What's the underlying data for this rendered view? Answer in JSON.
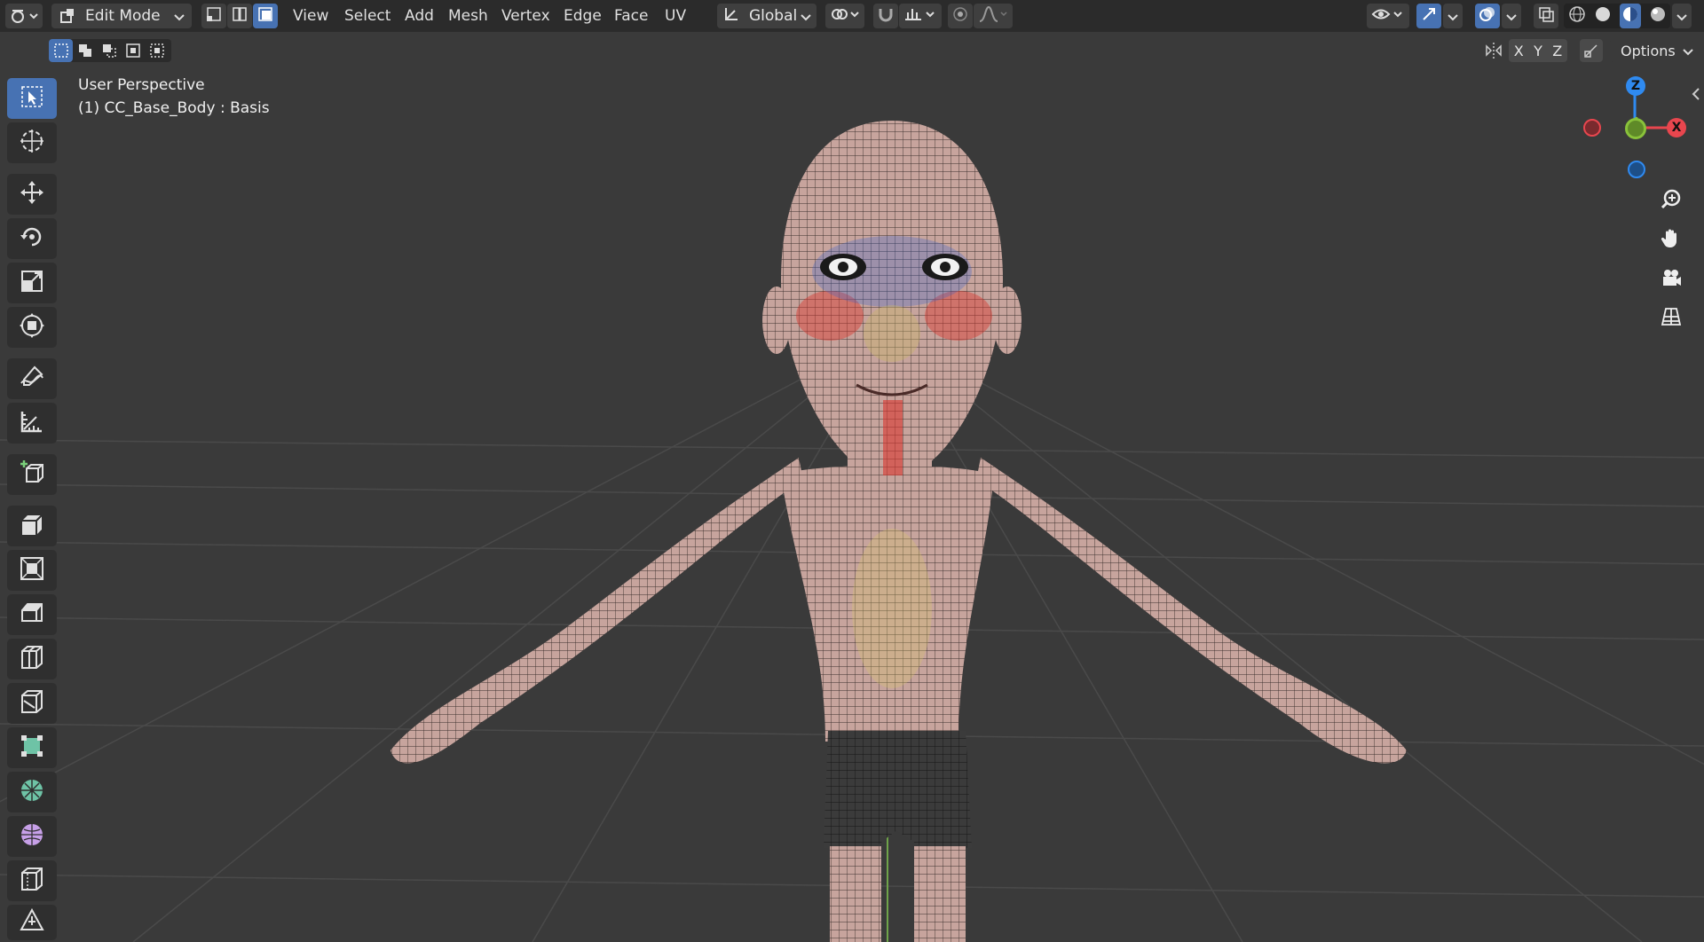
{
  "header": {
    "mode_label": "Edit Mode",
    "menus": [
      "View",
      "Select",
      "Add",
      "Mesh",
      "Vertex",
      "Edge",
      "Face",
      "UV"
    ],
    "transform_orientation": "Global",
    "options_label": "Options",
    "axis_labels": [
      "X",
      "Y",
      "Z"
    ]
  },
  "viewport": {
    "view_name": "User Perspective",
    "object_info": "(1) CC_Base_Body : Basis"
  },
  "gizmo": {
    "x_label": "X",
    "z_label": "Z",
    "colors": {
      "x": "#e8464e",
      "y": "#89c23a",
      "z": "#2f8af0"
    }
  },
  "toolbar": {
    "tools": [
      "select-box-icon",
      "cursor-icon",
      "move-icon",
      "rotate-icon",
      "scale-icon",
      "transform-icon",
      "annotate-icon",
      "measure-icon",
      "add-cube-icon",
      "extrude-icon",
      "inset-icon",
      "bevel-icon",
      "loop-cut-icon",
      "knife-icon",
      "poly-build-icon",
      "spin-icon",
      "smooth-icon",
      "edge-slide-icon",
      "shrink-fatten-icon"
    ]
  },
  "colors": {
    "accent": "#4772b3",
    "header_bg": "#2b2b2b",
    "viewport_bg": "#3a3a3a"
  }
}
